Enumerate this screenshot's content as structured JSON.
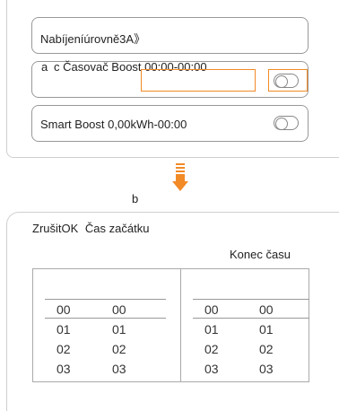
{
  "label_a": "a",
  "label_b": "b",
  "top_panel": {
    "charging_level_label": "Nabíjeníúrovně3A》",
    "boost_timer_label": "c Časovač Boost 00:00-00:00",
    "smart_boost_label": "Smart Boost 0,00kWh-00:00",
    "boost_timer_toggle_on": false,
    "smart_boost_toggle_on": false,
    "highlight_color": "#f28a26"
  },
  "arrow": {
    "icon": "arrow-down-icon",
    "color": "#f28a26"
  },
  "bottom_panel": {
    "cancel_ok_label": "ZrušitOK",
    "start_time_label": "Čas začátku",
    "end_time_label": "Konec času",
    "start_hours": [
      "00",
      "01",
      "02",
      "03"
    ],
    "start_minutes": [
      "00",
      "01",
      "02",
      "03"
    ],
    "end_hours": [
      "00",
      "01",
      "02",
      "03"
    ],
    "end_minutes": [
      "00",
      "01",
      "02",
      "03"
    ]
  }
}
